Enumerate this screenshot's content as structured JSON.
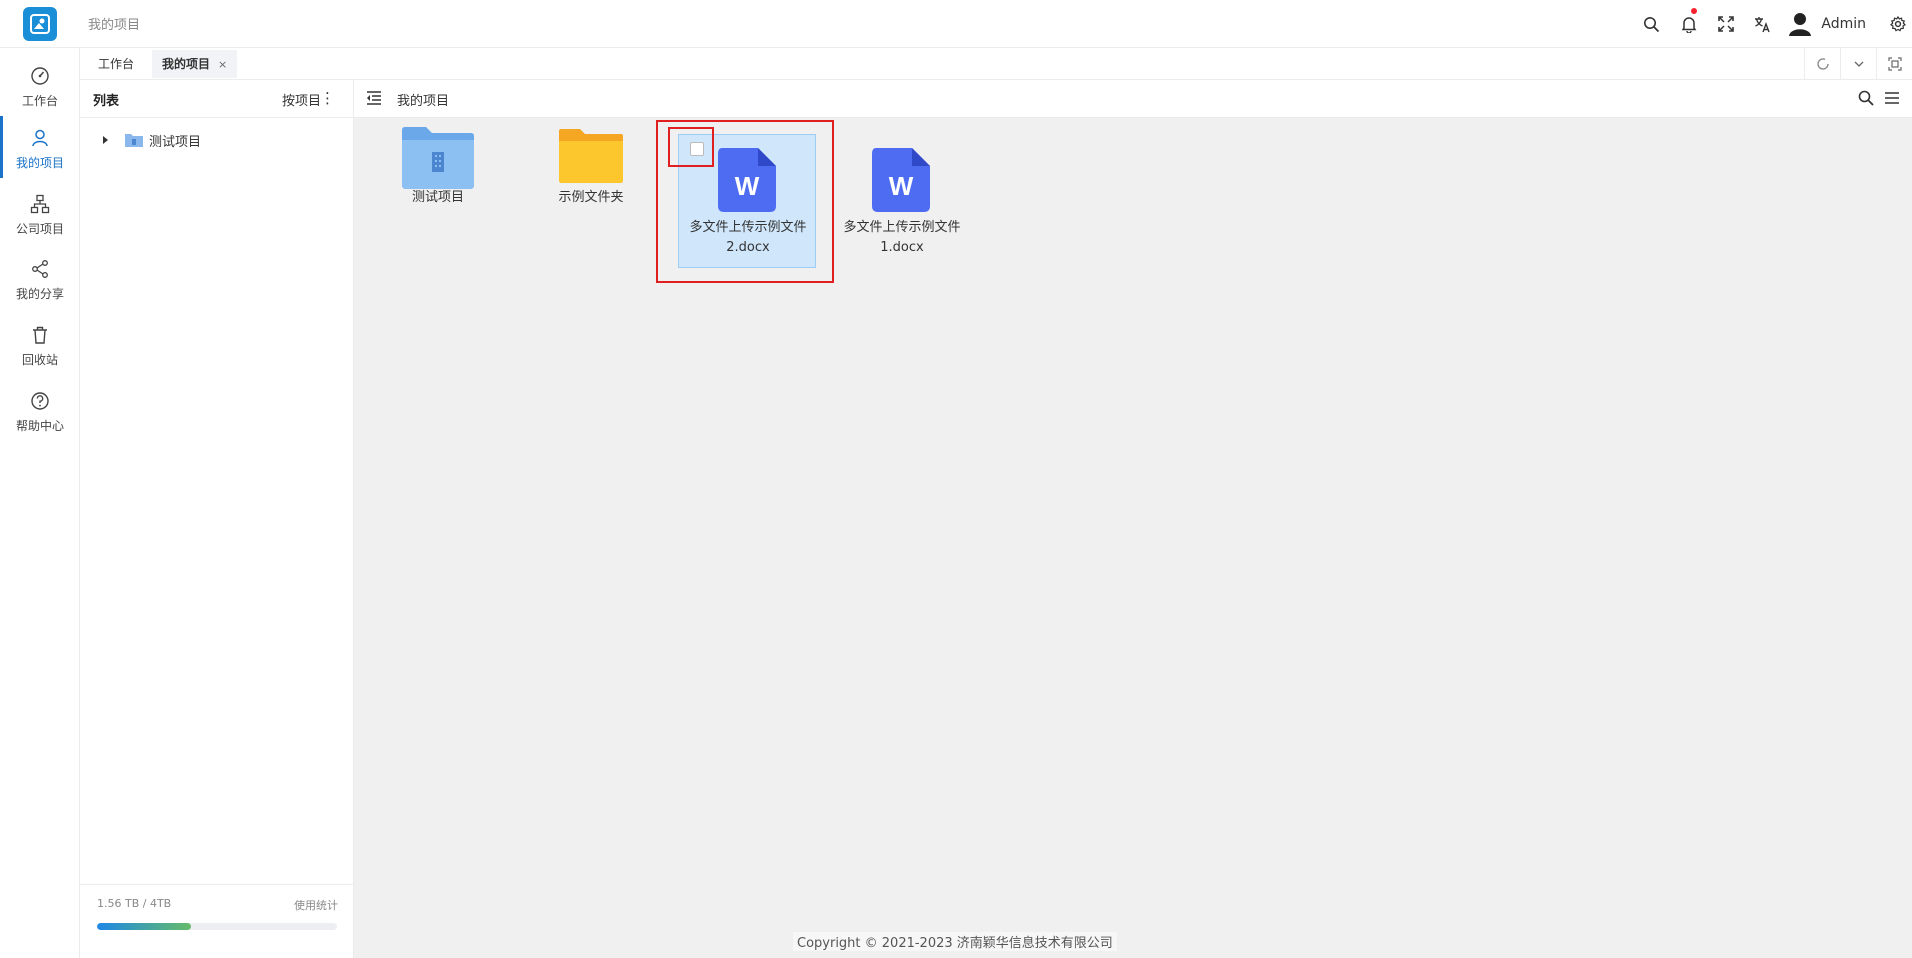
{
  "app": {
    "breadcrumb": "我的项目",
    "username": "Admin"
  },
  "nav": {
    "items": [
      {
        "label": "工作台",
        "icon": "dashboard-icon"
      },
      {
        "label": "我的项目",
        "icon": "user-icon",
        "active": true
      },
      {
        "label": "公司项目",
        "icon": "org-tree-icon"
      },
      {
        "label": "我的分享",
        "icon": "share-icon"
      },
      {
        "label": "回收站",
        "icon": "trash-icon"
      },
      {
        "label": "帮助中心",
        "icon": "help-icon"
      }
    ]
  },
  "tabs": [
    {
      "label": "工作台",
      "active": false
    },
    {
      "label": "我的项目",
      "active": true,
      "close": "×"
    }
  ],
  "panel": {
    "title": "列表",
    "sort_label": "按项目",
    "more": "⋮",
    "tree": [
      {
        "label": "测试项目"
      }
    ],
    "storage": {
      "text": "1.56 TB / 4TB",
      "stat_label": "使用统计",
      "used_fraction": 0.39
    }
  },
  "main": {
    "title": "我的项目",
    "files": [
      {
        "name": "测试项目",
        "type": "project-folder"
      },
      {
        "name": "示例文件夹",
        "type": "folder"
      },
      {
        "name_line1": "多文件上传示例文件",
        "name_line2": "2.docx",
        "type": "docx",
        "selected": true
      },
      {
        "name_line1": "多文件上传示例文件",
        "name_line2": "1.docx",
        "type": "docx",
        "selected": false
      }
    ]
  },
  "footer": "Copyright © 2021-2023 济南颖华信息技术有限公司",
  "colors": {
    "accent": "#1a73c9",
    "docx": "#4e6cf2",
    "folder": "#fbc02d",
    "project_folder": "#6aa8ea",
    "highlight": "#e02020"
  }
}
